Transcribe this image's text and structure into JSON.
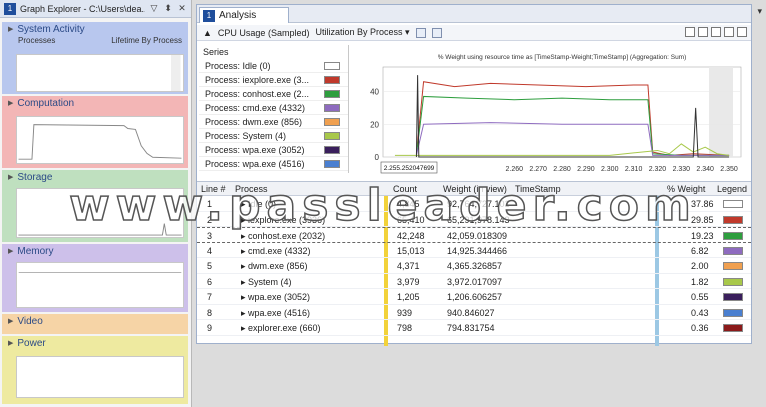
{
  "graph_explorer": {
    "badge": "1",
    "title": "Graph Explorer - C:\\Users\\dea...",
    "title_controls": [
      "▽",
      "⬍",
      "✕"
    ],
    "categories": [
      {
        "name": "System Activity",
        "sub_left": "Processes",
        "sub_right": "Lifetime By Process",
        "color": "#b8c7ee"
      },
      {
        "name": "Computation",
        "color": "#f3b6b6"
      },
      {
        "name": "Storage",
        "color": "#bfe0bf"
      },
      {
        "name": "Memory",
        "color": "#cdc0ea"
      },
      {
        "name": "Video",
        "color": "#f6d4a6"
      },
      {
        "name": "Power",
        "color": "#eeeaa0"
      }
    ]
  },
  "analysis": {
    "badge": "1",
    "tab_label": "Analysis",
    "toolbar_collapse": "▲",
    "graph_title": "CPU Usage (Sampled)",
    "preset": "Utilization By Process ▾",
    "series_header": "Series",
    "series": [
      {
        "name": "Process: Idle (0)",
        "color": "#ffffff"
      },
      {
        "name": "Process: iexplore.exe (3...",
        "color": "#c0392b"
      },
      {
        "name": "Process: conhost.exe (2...",
        "color": "#2e9e3e"
      },
      {
        "name": "Process: cmd.exe (4332)",
        "color": "#8e6bbf"
      },
      {
        "name": "Process: dwm.exe (856)",
        "color": "#f0a050"
      },
      {
        "name": "Process: System (4)",
        "color": "#a8c84a"
      },
      {
        "name": "Process: wpa.exe (3052)",
        "color": "#3a1f5c"
      },
      {
        "name": "Process: wpa.exe (4516)",
        "color": "#4a7fd0"
      }
    ]
  },
  "chart_data": {
    "type": "line",
    "title": "% Weight using resource time as [TimeStamp-Weight;TimeStamp] (Aggregation: Sum)",
    "xlabel": "",
    "ylabel": "",
    "ylim": [
      0,
      55
    ],
    "xlim": [
      2.205,
      2.355
    ],
    "y_ticks": [
      "40",
      "20",
      "0"
    ],
    "x_ticks": [
      "2.260",
      "2.270",
      "2.280",
      "2.290",
      "2.300",
      "2.310",
      "2.320",
      "2.330",
      "2.340",
      "2.350"
    ],
    "x_readout": "2.255.252047699",
    "series": [
      {
        "color": "#c0392b",
        "x": [
          2.219,
          2.222,
          2.235,
          2.25,
          2.27,
          2.29,
          2.31,
          2.316,
          2.318,
          2.325,
          2.335,
          2.35
        ],
        "y": [
          2,
          46,
          43,
          45,
          44,
          43,
          44,
          44,
          3,
          1,
          2,
          1
        ]
      },
      {
        "color": "#2e9e3e",
        "x": [
          2.219,
          2.222,
          2.24,
          2.26,
          2.28,
          2.3,
          2.316,
          2.318,
          2.33,
          2.35
        ],
        "y": [
          1,
          37,
          36,
          35,
          36,
          35,
          35,
          2,
          1,
          1
        ]
      },
      {
        "color": "#8e6bbf",
        "x": [
          2.219,
          2.222,
          2.25,
          2.28,
          2.31,
          2.316,
          2.318,
          2.35
        ],
        "y": [
          1,
          20,
          21,
          20,
          20,
          20,
          1,
          1
        ]
      },
      {
        "color": "#a8c84a",
        "x": [
          2.21,
          2.24,
          2.27,
          2.3,
          2.32,
          2.325,
          2.33,
          2.335,
          2.34,
          2.345,
          2.35
        ],
        "y": [
          1,
          1,
          1,
          1,
          4,
          2,
          8,
          3,
          6,
          2,
          1
        ]
      },
      {
        "color": "#333333",
        "x": [
          2.219,
          2.2195,
          2.22,
          2.335,
          2.336,
          2.337,
          2.35
        ],
        "y": [
          0,
          50,
          0,
          0,
          30,
          0,
          0
        ]
      }
    ]
  },
  "table": {
    "headers": [
      "Line #",
      "Process",
      "Count",
      "Weight (in view)",
      "TimeStamp",
      "% Weight",
      "Legend"
    ],
    "rows": [
      {
        "line": "1",
        "process": "Idle (0)",
        "count": "4,845",
        "weight": "92,764,727.101",
        "pct": "37.86",
        "color": "#ffffff"
      },
      {
        "line": "2",
        "process": "iexplore.exe (3936)",
        "count": "65,410",
        "weight": "65,291,978.143",
        "pct": "29.85",
        "color": "#c0392b"
      },
      {
        "line": "3",
        "process": "conhost.exe (2032)",
        "count": "42,248",
        "weight": "42,059.018309",
        "pct": "19.23",
        "color": "#2e9e3e"
      },
      {
        "line": "4",
        "process": "cmd.exe (4332)",
        "count": "15,013",
        "weight": "14,925.344466",
        "pct": "6.82",
        "color": "#8e6bbf"
      },
      {
        "line": "5",
        "process": "dwm.exe (856)",
        "count": "4,371",
        "weight": "4,365.326857",
        "pct": "2.00",
        "color": "#f0a050"
      },
      {
        "line": "6",
        "process": "System (4)",
        "count": "3,979",
        "weight": "3,972.017097",
        "pct": "1.82",
        "color": "#a8c84a"
      },
      {
        "line": "7",
        "process": "wpa.exe (3052)",
        "count": "1,205",
        "weight": "1,206.606257",
        "pct": "0.55",
        "color": "#3a1f5c"
      },
      {
        "line": "8",
        "process": "wpa.exe (4516)",
        "count": "939",
        "weight": "940.846027",
        "pct": "0.43",
        "color": "#4a7fd0"
      },
      {
        "line": "9",
        "process": "explorer.exe (660)",
        "count": "798",
        "weight": "794.831754",
        "pct": "0.36",
        "color": "#8b1a1a"
      }
    ]
  },
  "watermark": "www.passleader.com",
  "corner_mark": "▾"
}
